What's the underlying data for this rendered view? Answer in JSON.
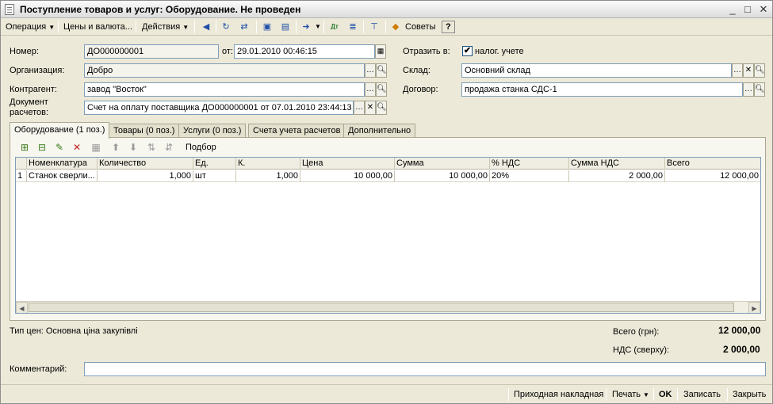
{
  "window": {
    "title": "Поступление товаров и услуг: Оборудование. Не проведен",
    "minimize": "_",
    "maximize": "□",
    "close": "✕"
  },
  "toolbar": {
    "operation": "Операция",
    "prices": "Цены и валюта...",
    "actions": "Действия",
    "tips": "Советы",
    "help": "?"
  },
  "form": {
    "number_label": "Номер:",
    "number": "ДО000000001",
    "date_label": "от:",
    "date": "29.01.2010 00:46:15",
    "reflect_label": "Отразить в:",
    "tax_label": "налог. учете",
    "tax_checked": "✔",
    "org_label": "Организация:",
    "org": "Добро",
    "warehouse_label": "Склад:",
    "warehouse": "Основний склад",
    "counterparty_label": "Контрагент:",
    "counterparty": "завод \"Восток\"",
    "contract_label": "Договор:",
    "contract": "продажа станка СДС-1",
    "settlement_label_1": "Документ",
    "settlement_label_2": "расчетов:",
    "settlement": "Счет на оплату поставщика ДО000000001 от 07.01.2010 23:44:13"
  },
  "tabs": [
    "Оборудование (1 поз.)",
    "Товары (0 поз.)",
    "Услуги (0 поз.)",
    "Счета учета расчетов",
    "Дополнительно"
  ],
  "grid_toolbar": {
    "selection": "Подбор"
  },
  "table": {
    "columns": [
      "",
      "Номенклатура",
      "Количество",
      "Ед.",
      "К.",
      "Цена",
      "Сумма",
      "% НДС",
      "Сумма НДС",
      "Всего"
    ],
    "rows": [
      [
        "1",
        "Станок сверли...",
        "1,000",
        "шт",
        "1,000",
        "10 000,00",
        "10 000,00",
        "20%",
        "2 000,00",
        "12 000,00"
      ]
    ]
  },
  "footer": {
    "price_type": "Тип цен: Основна ціна закупівлі",
    "total_label": "Всего (грн):",
    "total": "12 000,00",
    "vat_label": "НДС (сверху):",
    "vat": "2 000,00",
    "comment_label": "Комментарий:",
    "comment": ""
  },
  "bottom": {
    "invoice": "Приходная накладная",
    "print": "Печать",
    "ok": "OK",
    "save": "Записать",
    "close": "Закрыть"
  }
}
